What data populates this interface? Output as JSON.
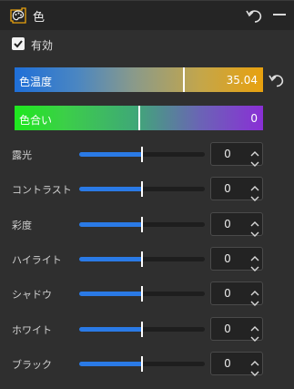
{
  "header": {
    "title": "色",
    "icon": "palette-icon"
  },
  "enable": {
    "label": "有効",
    "checked": true
  },
  "temperature": {
    "label": "色温度",
    "value": "35.04",
    "level": 0.68
  },
  "tint": {
    "label": "色合い",
    "value": "0",
    "level": 0.5
  },
  "adjustments": [
    {
      "label": "露光",
      "value": "0",
      "level": 0.5
    },
    {
      "label": "コントラスト",
      "value": "0",
      "level": 0.5
    },
    {
      "label": "彩度",
      "value": "0",
      "level": 0.5
    },
    {
      "label": "ハイライト",
      "value": "0",
      "level": 0.5
    },
    {
      "label": "シャドウ",
      "value": "0",
      "level": 0.5
    },
    {
      "label": "ホワイト",
      "value": "0",
      "level": 0.5
    },
    {
      "label": "ブラック",
      "value": "0",
      "level": 0.5
    }
  ],
  "colors": {
    "accent": "#2a7ae6",
    "panel": "#2f2f2f",
    "header": "#252525"
  }
}
